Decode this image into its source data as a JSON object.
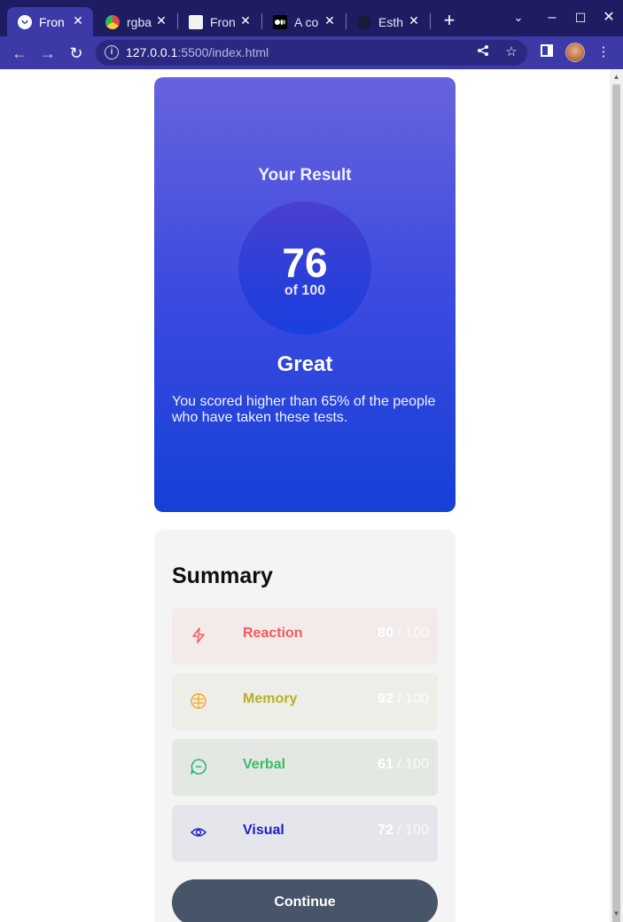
{
  "browser": {
    "tabs": [
      {
        "title": "Fron",
        "favicon": "frontend-mentor-icon"
      },
      {
        "title": "rgba",
        "favicon": "chrome-icon"
      },
      {
        "title": "Fron",
        "favicon": "page-icon"
      },
      {
        "title": "A co",
        "favicon": "medium-icon"
      },
      {
        "title": "Esth",
        "favicon": "github-icon"
      }
    ],
    "url_host": "127.0.0.1",
    "url_rest": ":5500/index.html"
  },
  "result": {
    "heading": "Your Result",
    "score": "76",
    "total": "of 100",
    "grade": "Great",
    "description": "You scored higher than 65% of the people who have taken these tests."
  },
  "summary": {
    "title": "Summary",
    "items": [
      {
        "label": "Reaction",
        "score": "80",
        "max": " / 100",
        "icon": "lightning-icon",
        "color": "#f25c5c",
        "bg": "#f3eaea"
      },
      {
        "label": "Memory",
        "score": "92",
        "max": " / 100",
        "icon": "brain-icon",
        "color": "#b8b025",
        "bg": "#eeeee8"
      },
      {
        "label": "Verbal",
        "score": "61",
        "max": " / 100",
        "icon": "chat-bubble-icon",
        "color": "#3fb86a",
        "bg": "#e3e8e3"
      },
      {
        "label": "Visual",
        "score": "72",
        "max": " / 100",
        "icon": "eye-icon",
        "color": "#1c1fc8",
        "bg": "#e5e6ec"
      }
    ],
    "continue_label": "Continue"
  }
}
